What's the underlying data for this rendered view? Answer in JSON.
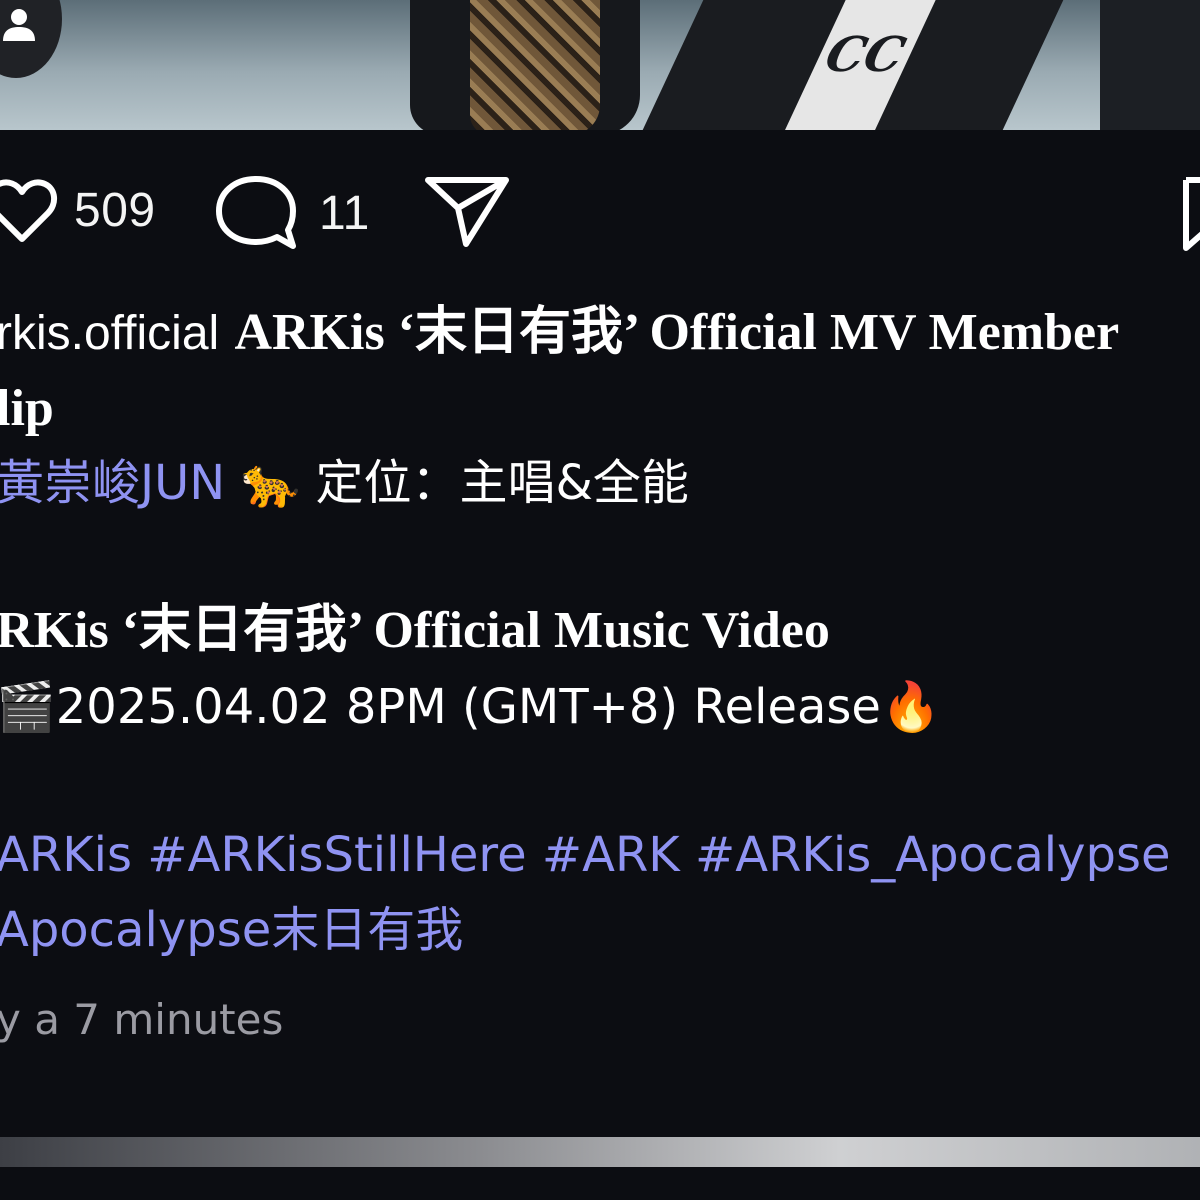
{
  "post": {
    "likes": "509",
    "comments": "11",
    "caption_line1_user": "rkis.official",
    "caption_line1_title": "ARKis ‘末日有我’ Official MV Member",
    "caption_line2": "lip",
    "caption_line3_link": "黃崇峻JUN",
    "caption_line3_emoji": "🐆",
    "caption_line3_text": "定位：主唱&全能",
    "caption_line4": "RKis ‘末日有我’ Official Music Video",
    "caption_line5_emoji": "🎬",
    "caption_line5_text": "2025.04.02 8PM (GMT+8) Release",
    "caption_line5_end_emoji": "🔥",
    "hashtags_line1": "ARKis #ARKisStillHere #ARK #ARKis_Apocalypse",
    "hashtags_line2": "Apocalypse末日有我",
    "timestamp": "y a 7 minutes"
  },
  "icons": {
    "like": "heart-icon",
    "comment": "comment-bubble-icon",
    "share": "send-icon",
    "save": "bookmark-icon",
    "avatar": "user-icon"
  },
  "colors": {
    "background": "#0c0d12",
    "link": "#8f93f2",
    "muted": "#9b9ba3"
  }
}
